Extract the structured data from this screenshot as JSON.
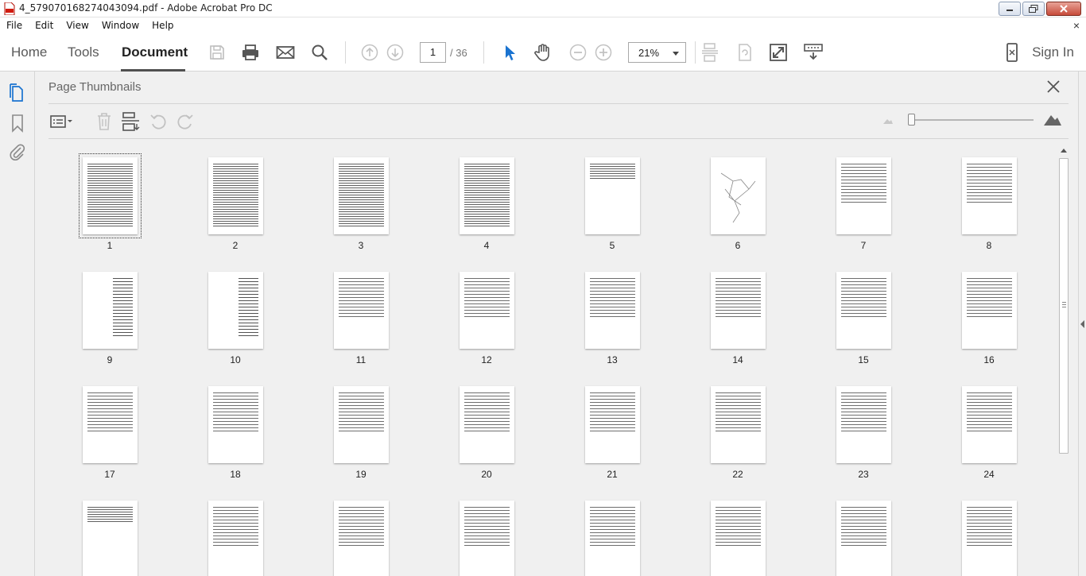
{
  "window": {
    "title": "4_5790701682740430​94.pdf - Adobe Acrobat Pro DC"
  },
  "menu": [
    "File",
    "Edit",
    "View",
    "Window",
    "Help"
  ],
  "menu_close": "×",
  "toolbar": {
    "tabs": [
      "Home",
      "Tools",
      "Document"
    ],
    "active_tab": "Document",
    "current_page": "1",
    "page_total": "/ 36",
    "zoom": "21%",
    "signin": "Sign In"
  },
  "panel": {
    "title": "Page Thumbnails"
  },
  "thumbnails": [
    "1",
    "2",
    "3",
    "4",
    "5",
    "6",
    "7",
    "8",
    "9",
    "10",
    "11",
    "12",
    "13",
    "14",
    "15",
    "16",
    "17",
    "18",
    "19",
    "20",
    "21",
    "22",
    "23",
    "24",
    "",
    "",
    "",
    "",
    "",
    "",
    "",
    ""
  ]
}
